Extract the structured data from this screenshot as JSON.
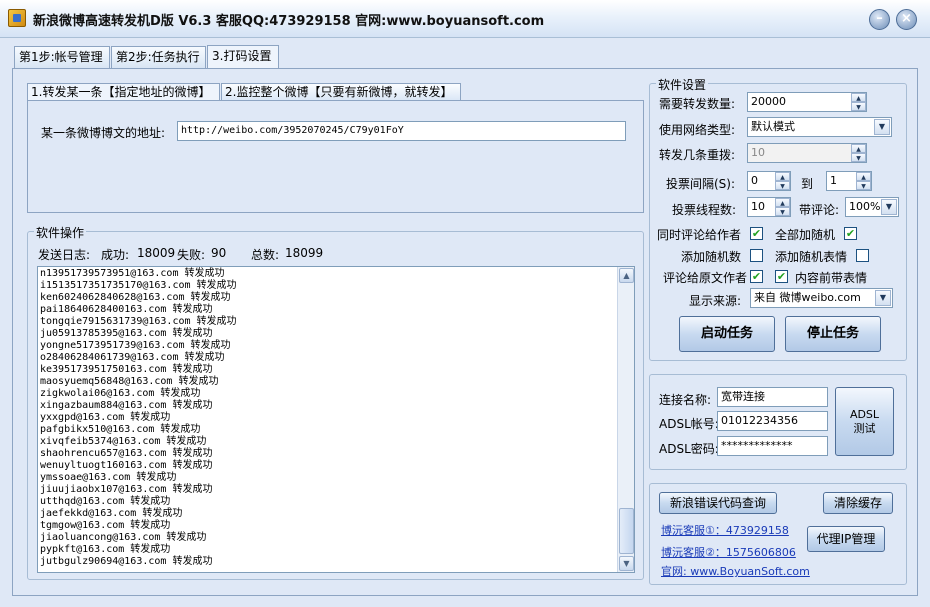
{
  "window": {
    "title": "新浪微博高速转发机D版 V6.3 客服QQ:473929158 官网:www.boyuansoft.com",
    "min_label": "–",
    "close_label": "×"
  },
  "main_tabs": [
    "第1步:帐号管理",
    "第2步:任务执行",
    "3.打码设置"
  ],
  "inner_tabs": [
    "1.转发某一条【指定地址的微博】",
    "2.监控整个微博【只要有新微博，就转发】"
  ],
  "address": {
    "label": "某一条微博博文的地址:",
    "value": "http://weibo.com/3952070245/C79y01FoY"
  },
  "ops": {
    "title": "软件操作",
    "log_label": "发送日志:",
    "success_label": "成功:",
    "success": "18009",
    "fail_label": "失败:",
    "fail": "90",
    "total_label": "总数:",
    "total": "18099"
  },
  "log_lines": [
    "n13951739573951@163.com 转发成功",
    "i1513517351735170@163.com 转发成功",
    "ken6024062840628@163.com 转发成功",
    "pai18640628400163.com 转发成功",
    "tongqie7915631739@163.com 转发成功",
    "ju05913785395@163.com 转发成功",
    "yongne5173951739@163.com 转发成功",
    "o28406284061739@163.com 转发成功",
    "ke395173951750163.com 转发成功",
    "maosyuemq56848@163.com 转发成功",
    "zigkwolai06@163.com 转发成功",
    "xingazbaum884@163.com 转发成功",
    "yxxgpd@163.com 转发成功",
    "pafgbikx510@163.com 转发成功",
    "xivqfeib5374@163.com 转发成功",
    "shaohrencu657@163.com 转发成功",
    "wenuyltuogt160163.com 转发成功",
    "ymssoae@163.com 转发成功",
    "jiuujiaobx107@163.com 转发成功",
    "utthqd@163.com 转发成功",
    "jaefekkd@163.com 转发成功",
    "tgmgow@163.com 转发成功",
    "jiaoluancong@163.com 转发成功",
    "pypkft@163.com 转发成功",
    "jutbgulz90694@163.com 转发成功"
  ],
  "settings": {
    "title": "软件设置",
    "repost_count_label": "需要转发数量:",
    "repost_count": "20000",
    "network_label": "使用网络类型:",
    "network": "默认模式",
    "retry_label": "转发几条重拨:",
    "retry": "10",
    "interval_label": "投票间隔(S):",
    "interval_from": "0",
    "interval_to_label": "到",
    "interval_to": "1",
    "threads_label": "投票线程数:",
    "threads": "10",
    "comment_label": "带评论:",
    "comment_pct": "100%",
    "also_comment_author": "同时评论给作者",
    "all_random": "全部加随机",
    "add_random_number": "添加随机数",
    "add_random_emoji": "添加随机表情",
    "comment_original_author": "评论给原文作者",
    "content_emoji_front": "内容前带表情",
    "source_label": "显示来源:",
    "source": "来自 微博weibo.com",
    "start_button": "启动任务",
    "stop_button": "停止任务"
  },
  "adsl": {
    "conn_name_label": "连接名称:",
    "conn_name": "宽带连接",
    "account_label": "ADSL帐号:",
    "account": "01012234356",
    "password_label": "ADSL密码:",
    "password": "*************",
    "test_button_line1": "ADSL",
    "test_button_line2": "测试"
  },
  "support": {
    "error_query_button": "新浪错误代码查询",
    "clear_cache_button": "清除缓存",
    "service1": "博沅客服①：473929158",
    "service2": "博沅客服②：1575606806",
    "website": "官网: www.BoyuanSoft.com",
    "proxy_button": "代理IP管理"
  }
}
